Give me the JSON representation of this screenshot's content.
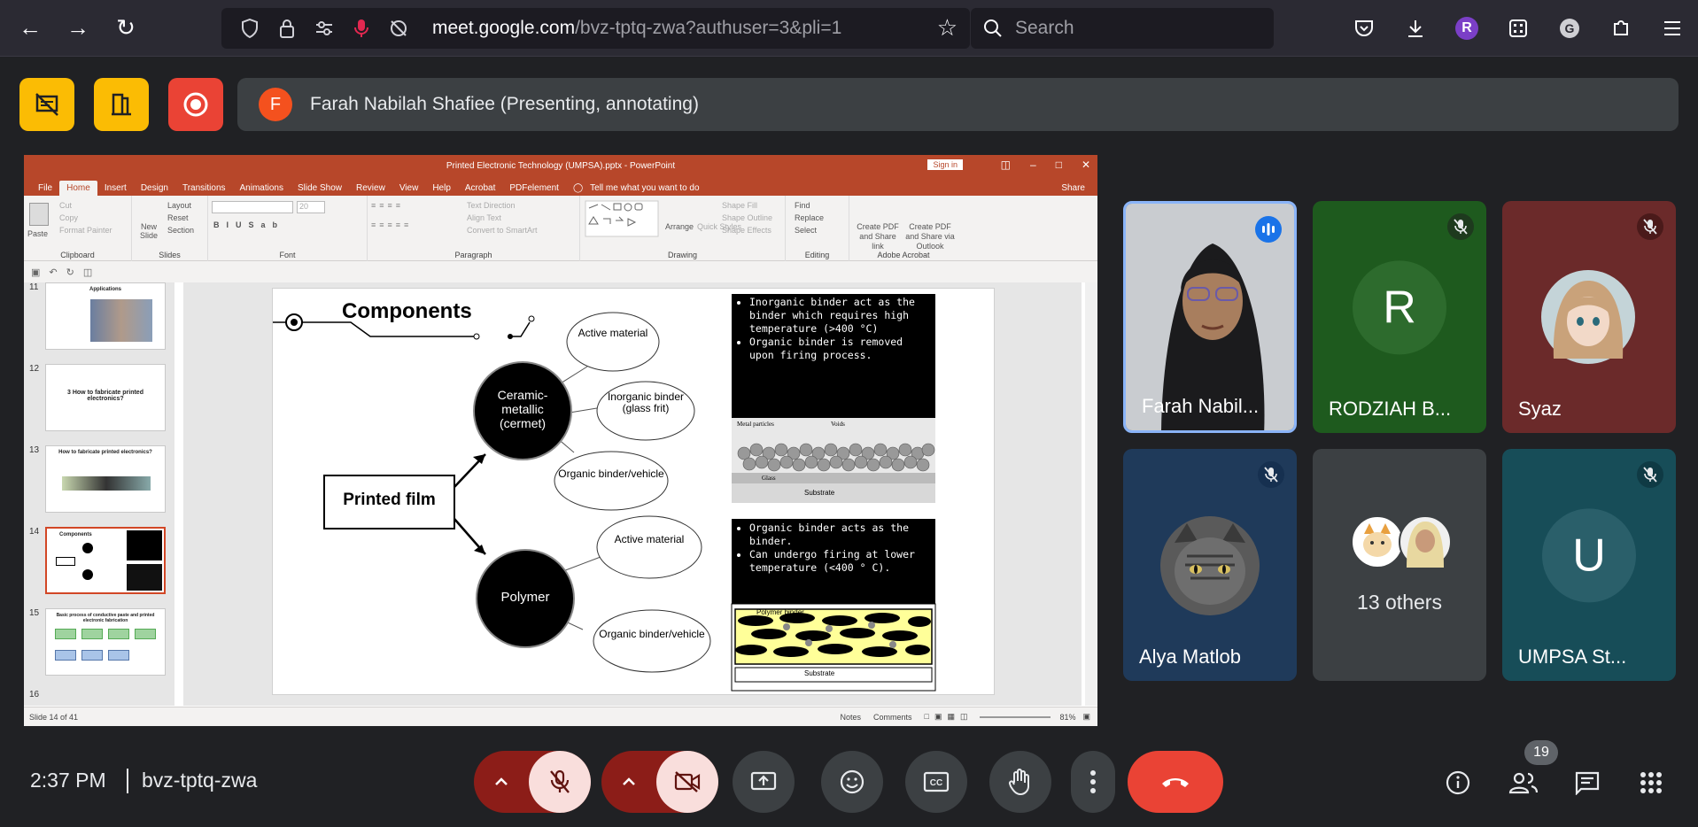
{
  "browser": {
    "url_domain": "meet.google.com",
    "url_path": "/bvz-tptq-zwa?authuser=3&pli=1",
    "search_placeholder": "Search",
    "profile_letter": "R"
  },
  "presenter": {
    "avatar_letter": "F",
    "label": "Farah Nabilah Shafiee (Presenting, annotating)"
  },
  "powerpoint": {
    "window_title": "Printed Electronic Technology (UMPSA).pptx - PowerPoint",
    "sign_in": "Sign in",
    "tabs": [
      "File",
      "Home",
      "Insert",
      "Design",
      "Transitions",
      "Animations",
      "Slide Show",
      "Review",
      "View",
      "Help",
      "Acrobat",
      "PDFelement"
    ],
    "tell_me": "Tell me what you want to do",
    "share": "Share",
    "ribbon_groups": [
      {
        "name": "Clipboard",
        "items": [
          "Paste",
          "Cut",
          "Copy",
          "Format Painter"
        ]
      },
      {
        "name": "Slides",
        "items": [
          "New Slide",
          "Layout",
          "Reset",
          "Section"
        ]
      },
      {
        "name": "Font",
        "items": []
      },
      {
        "name": "Paragraph",
        "items": [
          "Text Direction",
          "Align Text",
          "Convert to SmartArt"
        ]
      },
      {
        "name": "Drawing",
        "items": [
          "Arrange",
          "Quick Styles",
          "Shape Fill",
          "Shape Outline",
          "Shape Effects"
        ]
      },
      {
        "name": "Editing",
        "items": [
          "Find",
          "Replace",
          "Select"
        ]
      },
      {
        "name": "Adobe Acrobat",
        "items": [
          "Create PDF and Share link",
          "Create PDF and Share via Outlook"
        ]
      }
    ],
    "font_size": "20",
    "thumbnails": [
      {
        "num": "11",
        "caption": "Applications"
      },
      {
        "num": "12",
        "caption": "3   How to fabricate printed electronics?"
      },
      {
        "num": "13",
        "caption": "How to fabricate printed electronics?"
      },
      {
        "num": "14",
        "caption": "Components"
      },
      {
        "num": "15",
        "caption": "Basic process of conductive paste and printed electronic fabrication"
      },
      {
        "num": "16",
        "caption": ""
      }
    ],
    "status_left": "Slide 14 of 41",
    "notes": "Notes",
    "comments": "Comments",
    "zoom": "81%",
    "slide": {
      "title": "Components",
      "printed_film": "Printed film",
      "cermet": "Ceramic-metallic (cermet)",
      "polymer": "Polymer",
      "active_material_1": "Active material",
      "inorganic_binder": "Inorganic binder (glass frit)",
      "organic_binder_1": "Organic binder/vehicle",
      "active_material_2": "Active material",
      "organic_binder_2": "Organic binder/vehicle",
      "box1_bullets": [
        "Inorganic binder act as the binder which requires high temperature (>400 °C)",
        "Organic binder is removed upon firing process."
      ],
      "box1_img_labels": {
        "metal": "Metal particles",
        "voids": "Voids",
        "glass": "Glass",
        "substrate": "Substrate"
      },
      "box2_bullets": [
        "Organic binder acts as the binder.",
        "Can undergo firing at lower temperature (<400 ° C)."
      ],
      "box2_img_labels": {
        "polymer": "Polymer binder",
        "substrate": "Substrate"
      }
    }
  },
  "participants": [
    {
      "name": "Farah Nabil...",
      "state": "speaking",
      "bg": "#3a3f44"
    },
    {
      "name": "RODZIAH B...",
      "letter": "R",
      "state": "muted",
      "bg": "#1e5a1e",
      "avatar_bg": "#2d6b2d"
    },
    {
      "name": "Syaz",
      "state": "muted",
      "bg": "#6b2a2a"
    },
    {
      "name": "Alya Matlob",
      "state": "muted",
      "bg": "#1f3a5a"
    },
    {
      "name": "13 others",
      "state": "group",
      "bg": "#3c4043"
    },
    {
      "name": "UMPSA St...",
      "letter": "U",
      "state": "muted",
      "bg": "#174d58",
      "avatar_bg": "#2a5f6a"
    }
  ],
  "bottom": {
    "time": "2:37 PM",
    "meeting_code": "bvz-tptq-zwa",
    "participant_count": "19"
  },
  "colors": {
    "accent_red": "#ea4335",
    "yellow": "#fbbc04",
    "ppt_red": "#b7472a"
  }
}
